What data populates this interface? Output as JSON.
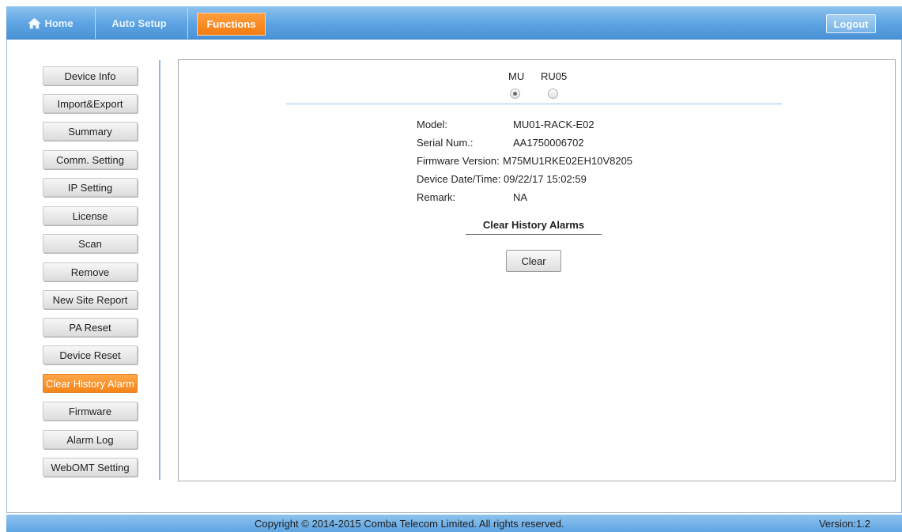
{
  "nav": {
    "home": "Home",
    "auto_setup": "Auto Setup",
    "functions": "Functions",
    "logout": "Logout"
  },
  "sidebar": {
    "items": [
      {
        "label": "Device Info"
      },
      {
        "label": "Import&Export"
      },
      {
        "label": "Summary"
      },
      {
        "label": "Comm. Setting"
      },
      {
        "label": "IP Setting"
      },
      {
        "label": "License"
      },
      {
        "label": "Scan"
      },
      {
        "label": "Remove"
      },
      {
        "label": "New Site Report"
      },
      {
        "label": "PA Reset"
      },
      {
        "label": "Device Reset"
      },
      {
        "label": "Clear History Alarm",
        "active": true
      },
      {
        "label": "Firmware"
      },
      {
        "label": "Alarm Log"
      },
      {
        "label": "WebOMT Setting"
      }
    ]
  },
  "device_select": {
    "options": [
      "MU",
      "RU05"
    ],
    "selected": "MU"
  },
  "info": {
    "model_label": "Model:",
    "model": "MU01-RACK-E02",
    "serial_label": "Serial Num.:",
    "serial": "AA1750006702",
    "firmware_label": "Firmware Version:",
    "firmware": "M75MU1RKE02EH10V8205",
    "datetime_label": "Device Date/Time:",
    "datetime": "09/22/17 15:02:59",
    "remark_label": "Remark:",
    "remark": "NA"
  },
  "clear_section": {
    "title": "Clear History Alarms",
    "button": "Clear"
  },
  "footer": {
    "copyright": "Copyright © 2014-2015 Comba Telecom Limited. All rights reserved.",
    "version": "Version:1.2"
  },
  "colors": {
    "accent": "#f48519",
    "nav_blue": "#5fa5e3"
  }
}
